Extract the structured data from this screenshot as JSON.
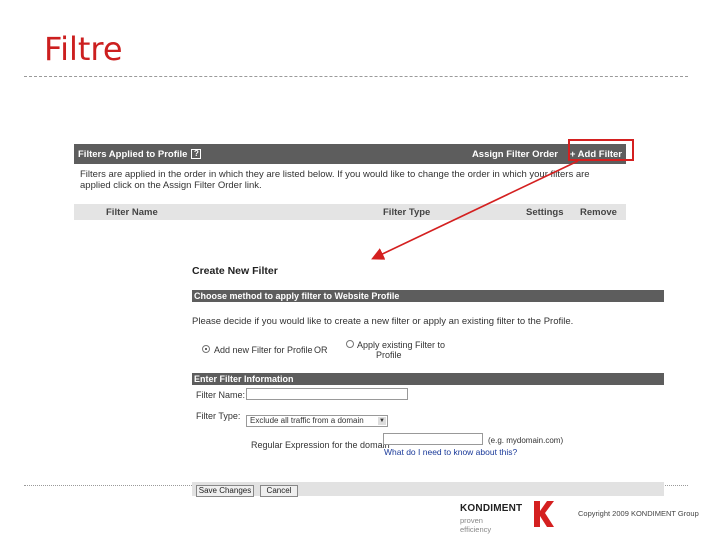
{
  "slide": {
    "title": "Filtre"
  },
  "filters_applied": {
    "header_title": "Filters Applied to Profile",
    "help_icon": "?",
    "assign_order_link": "Assign Filter Order",
    "add_filter_link": "+ Add Filter",
    "description": "Filters are applied in the order in which they are listed below. If you would like to change the order in which your filters are applied click on the Assign Filter Order link.",
    "columns": [
      "Filter Name",
      "Filter Type",
      "Settings",
      "Remove"
    ]
  },
  "create_filter": {
    "title": "Create New Filter",
    "method_section": "Choose method to apply filter to Website Profile",
    "method_question": "Please decide if you would like to create a new filter or apply an existing filter to the Profile.",
    "option_new": "Add new Filter for Profile",
    "or_label": "OR",
    "option_existing_line1": "Apply existing Filter to",
    "option_existing_line2": "Profile",
    "info_section": "Enter Filter Information",
    "filter_name_label": "Filter Name:",
    "filter_name_value": "",
    "filter_type_label": "Filter Type:",
    "filter_type_value": "Exclude all traffic from a domain",
    "domain_label": "Regular Expression for the domain",
    "domain_value": "",
    "domain_example": "(e.g. mydomain.com)",
    "help_link": "What do I need to know about this?",
    "save_button": "Save Changes",
    "cancel_button": "Cancel"
  },
  "footer": {
    "brand": "KONDIMENT",
    "tagline": "proven efficiency",
    "copyright": "Copyright 2009 KONDIMENT Group"
  },
  "colors": {
    "title_red": "#cc1f1f",
    "header_gray": "#5d5d5d",
    "highlight_red": "#d42020",
    "link_blue": "#1a3a9a"
  }
}
